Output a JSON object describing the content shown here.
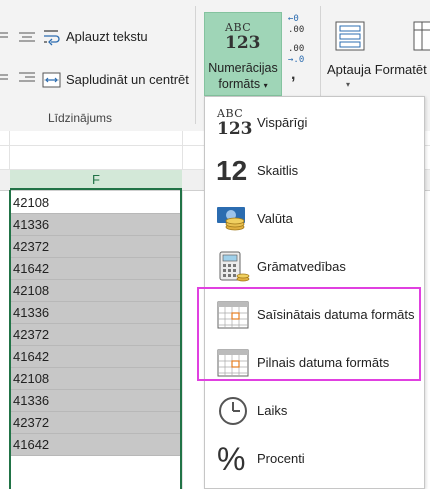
{
  "ribbon": {
    "wrap_text": "Aplauzt tekstu",
    "merge_center": "Sapludināt un centrēt",
    "alignment_group": "Līdzinājums",
    "number_format_line1": "Numerācijas",
    "number_format_line2": "formāts",
    "number_icon_abc": "ABC",
    "number_icon_123": "123",
    "conditional_format": "Aptauja Formatēt",
    "comma": ",",
    "inc_decimal_top": "←0",
    "inc_decimal_bottom": ".00",
    "dec_decimal_top": ".00",
    "dec_decimal_bottom": "→.0"
  },
  "sheet": {
    "column_header": "F",
    "cells": [
      "42108",
      "41336",
      "42372",
      "41642",
      "42108",
      "41336",
      "42372",
      "41642",
      "42108",
      "41336",
      "42372",
      "41642"
    ]
  },
  "menu": {
    "items": [
      {
        "label": "Vispārīgi",
        "icon": "general-format-icon",
        "icon_top": "ABC",
        "icon_bottom": "123"
      },
      {
        "label": "Skaitlis",
        "icon": "number-format-icon",
        "icon_text": "12"
      },
      {
        "label": "Valūta",
        "icon": "currency-icon"
      },
      {
        "label": "Grāmatvedības",
        "icon": "accounting-icon"
      },
      {
        "label": "Saīsinātais datuma formāts",
        "icon": "short-date-icon"
      },
      {
        "label": "Pilnais datuma formāts",
        "icon": "long-date-icon"
      },
      {
        "label": "Laiks",
        "icon": "clock-icon"
      },
      {
        "label": "Procenti",
        "icon": "percent-icon",
        "icon_text": "%"
      }
    ]
  },
  "colors": {
    "accent": "#217346",
    "button_selected": "#9fd5b7",
    "highlight": "#e040e0",
    "selection_fill": "#c7c7c7"
  }
}
